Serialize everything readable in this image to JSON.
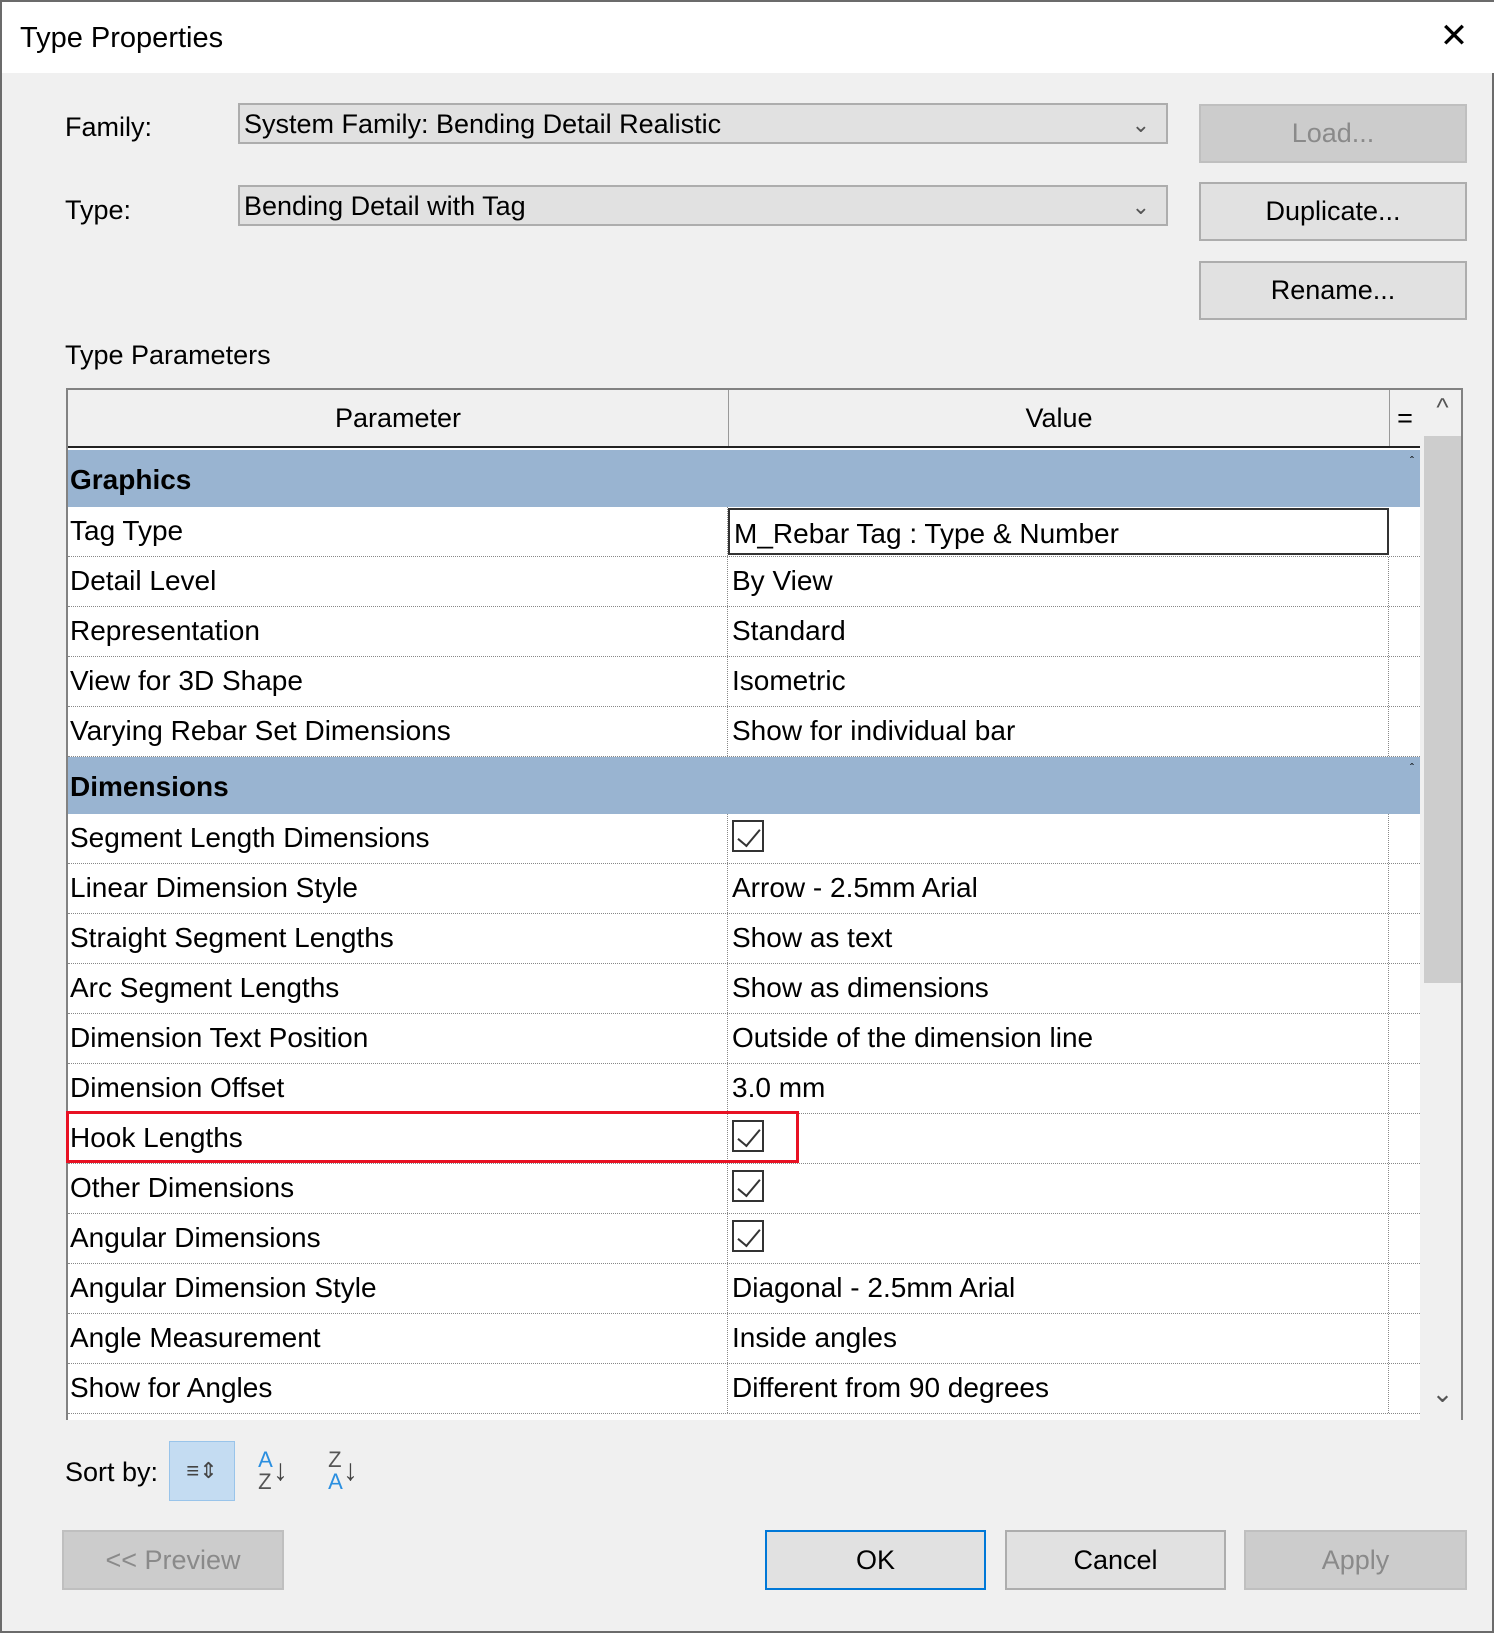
{
  "window": {
    "title": "Type Properties",
    "close": "✕"
  },
  "family": {
    "label": "Family:",
    "value": "System Family: Bending Detail Realistic"
  },
  "type": {
    "label": "Type:",
    "value": "Bending Detail with Tag"
  },
  "buttons": {
    "load": "Load...",
    "duplicate": "Duplicate...",
    "rename": "Rename...",
    "preview": "<< Preview",
    "ok": "OK",
    "cancel": "Cancel",
    "apply": "Apply"
  },
  "section_label": "Type Parameters",
  "table": {
    "col_parameter": "Parameter",
    "col_value": "Value",
    "col_eq": "=",
    "groups": [
      {
        "name": "Graphics",
        "rows": [
          {
            "p": "Tag Type",
            "v": "M_Rebar Tag : Type & Number"
          },
          {
            "p": "Detail Level",
            "v": "By View"
          },
          {
            "p": "Representation",
            "v": "Standard"
          },
          {
            "p": "View for 3D Shape",
            "v": "Isometric"
          },
          {
            "p": "Varying Rebar Set Dimensions",
            "v": "Show for individual bar"
          }
        ]
      },
      {
        "name": "Dimensions",
        "rows": [
          {
            "p": "Segment Length Dimensions",
            "checked": true
          },
          {
            "p": "Linear Dimension Style",
            "v": "Arrow - 2.5mm Arial"
          },
          {
            "p": "Straight Segment Lengths",
            "v": "Show as text"
          },
          {
            "p": "Arc Segment Lengths",
            "v": "Show as dimensions"
          },
          {
            "p": "Dimension Text Position",
            "v": "Outside of the dimension line"
          },
          {
            "p": "Dimension Offset",
            "v": "3.0 mm"
          },
          {
            "p": "Hook Lengths",
            "checked": true
          },
          {
            "p": "Other Dimensions",
            "checked": true
          },
          {
            "p": "Angular Dimensions",
            "checked": true
          },
          {
            "p": "Angular Dimension Style",
            "v": "Diagonal - 2.5mm Arial"
          },
          {
            "p": "Angle Measurement",
            "v": "Inside angles"
          },
          {
            "p": "Show for Angles",
            "v": "Different from 90 degrees"
          }
        ]
      }
    ]
  },
  "sort": {
    "label": "Sort by:",
    "options": [
      "grouped",
      "ascending",
      "descending"
    ],
    "selected": "grouped"
  }
}
